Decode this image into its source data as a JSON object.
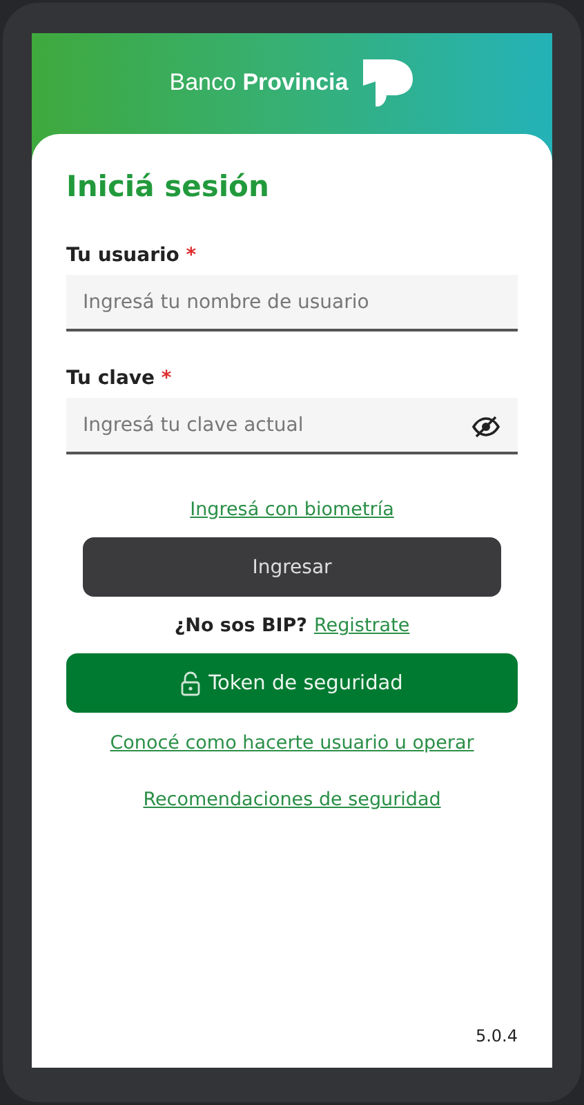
{
  "header": {
    "brand_regular": "Banco",
    "brand_bold": "Provincia"
  },
  "title": "Iniciá sesión",
  "fields": [
    {
      "label": "Tu usuario",
      "required_mark": "*",
      "placeholder": "Ingresá tu nombre de usuario",
      "kind": "text"
    },
    {
      "label": "Tu clave",
      "required_mark": "*",
      "placeholder": "Ingresá tu clave actual",
      "kind": "password"
    }
  ],
  "biometric_link": "Ingresá con biometría",
  "login_button": {
    "label": "Ingresar",
    "disabled": true
  },
  "register": {
    "question": "¿No sos BIP?",
    "link": "Registrate"
  },
  "token_button": "Token de seguridad",
  "links": [
    "Conocé como hacerte usuario u operar",
    "Recomendaciones de seguridad"
  ],
  "version": "5.0.4"
}
